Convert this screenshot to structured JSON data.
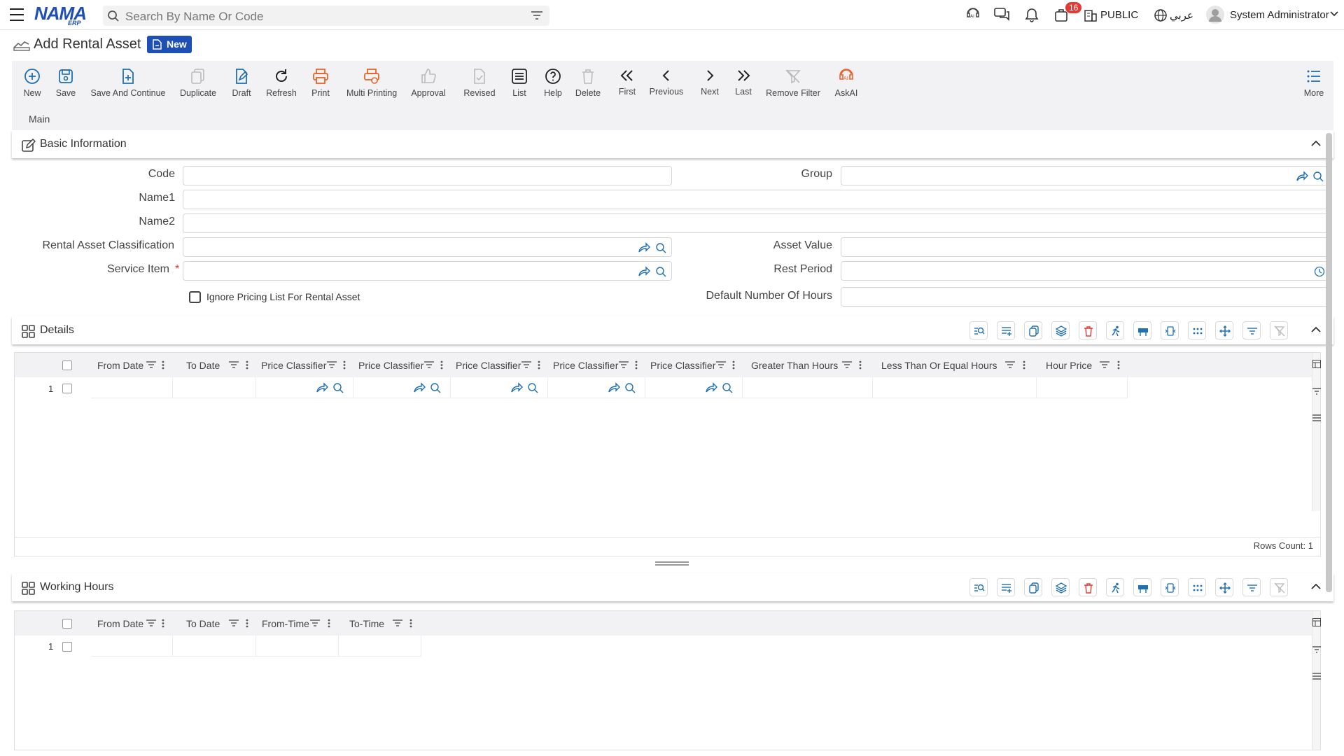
{
  "header": {
    "search_placeholder": "Search By Name Or Code",
    "notification_count": "16",
    "branch_label": "PUBLIC",
    "language_label": "عربي",
    "user_name": "System Administrator",
    "logo_main": "NAMA",
    "logo_sub": "ERP"
  },
  "page": {
    "title": "Add Rental Asset",
    "status_badge": "New"
  },
  "toolbar": {
    "new": "New",
    "save": "Save",
    "save_continue": "Save And Continue",
    "duplicate": "Duplicate",
    "draft": "Draft",
    "refresh": "Refresh",
    "print": "Print",
    "multi_printing": "Multi Printing",
    "approval": "Approval",
    "revised": "Revised",
    "list": "List",
    "help": "Help",
    "delete": "Delete",
    "first": "First",
    "previous": "Previous",
    "next": "Next",
    "last": "Last",
    "remove_filter": "Remove Filter",
    "askai": "AskAI",
    "more": "More"
  },
  "tabs": {
    "main": "Main"
  },
  "basic_info": {
    "title": "Basic Information",
    "code_label": "Code",
    "code_value": "",
    "group_label": "Group",
    "group_value": "",
    "name1_label": "Name1",
    "name1_value": "",
    "name2_label": "Name2",
    "name2_value": "",
    "classification_label": "Rental Asset Classification",
    "classification_value": "",
    "asset_value_label": "Asset Value",
    "asset_value_value": "",
    "service_item_label": "Service Item",
    "required_mark": "*",
    "service_item_value": "",
    "rest_period_label": "Rest Period",
    "rest_period_value": "",
    "ignore_pricing_label": "Ignore Pricing List For Rental Asset",
    "ignore_pricing_checked": false,
    "default_hours_label": "Default Number Of Hours",
    "default_hours_value": ""
  },
  "details": {
    "title": "Details",
    "columns": [
      "From Date",
      "To Date",
      "Price Classifier",
      "Price Classifier",
      "Price Classifier",
      "Price Classifier",
      "Price Classifier",
      "Greater Than Hours",
      "Less Than Or Equal Hours",
      "Hour Price"
    ],
    "rows": [
      {
        "num": "1"
      }
    ],
    "rows_count": "Rows Count: 1"
  },
  "working_hours": {
    "title": "Working Hours",
    "columns": [
      "From Date",
      "To Date",
      "From-Time",
      "To-Time"
    ],
    "rows": [
      {
        "num": "1"
      }
    ]
  },
  "colors": {
    "accent": "#1e4fb5",
    "toolbar_orange": "#e8632b",
    "icon_blue": "#1e6fb5",
    "badge_red": "#e53935"
  }
}
